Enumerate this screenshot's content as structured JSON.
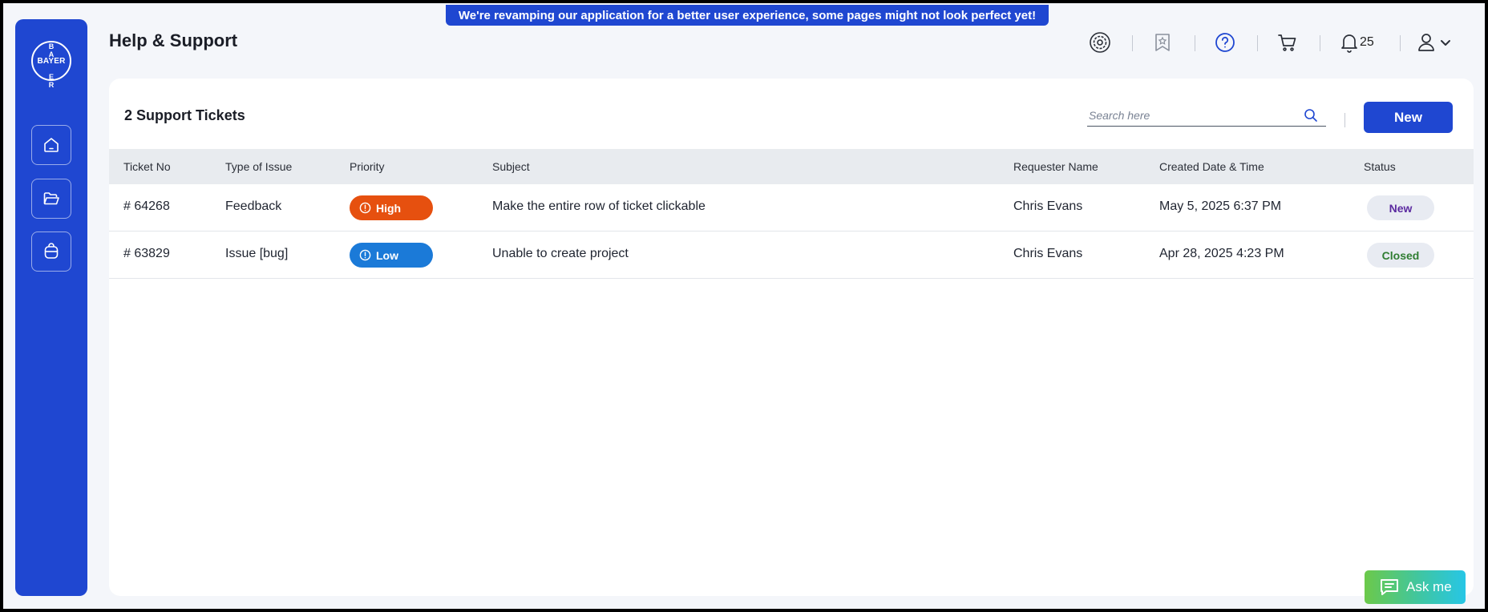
{
  "banner": {
    "text": "We're revamping our application for a better user experience, some pages might not look perfect yet!"
  },
  "sidebar": {
    "logo_text": "BAYER",
    "items": [
      {
        "name": "home",
        "icon": "home-icon"
      },
      {
        "name": "folder",
        "icon": "folder-icon"
      },
      {
        "name": "bag",
        "icon": "bag-icon"
      }
    ]
  },
  "header": {
    "title": "Help & Support",
    "icons": [
      "settings-gear-icon",
      "bookmark-badge-icon",
      "help-question-icon",
      "cart-icon",
      "bell-icon",
      "user-icon",
      "chevron-down-icon"
    ],
    "notification_count": "25"
  },
  "tickets": {
    "title": "2 Support Tickets",
    "search_placeholder": "Search here",
    "new_button": "New",
    "columns": [
      "Ticket No",
      "Type of Issue",
      "Priority",
      "Subject",
      "Requester Name",
      "Created Date & Time",
      "Status"
    ],
    "rows": [
      {
        "ticket_no": "# 64268",
        "type": "Feedback",
        "priority": "High",
        "subject": "Make the entire row of ticket clickable",
        "requester": "Chris Evans",
        "created": "May 5, 2025 6:37 PM",
        "status": "New"
      },
      {
        "ticket_no": "# 63829",
        "type": "Issue [bug]",
        "priority": "Low",
        "subject": "Unable to create project",
        "requester": "Chris Evans",
        "created": "Apr 28, 2025 4:23 PM",
        "status": "Closed"
      }
    ]
  },
  "colors": {
    "brand": "#1f47d1",
    "priority_high": "#e6500f",
    "priority_low": "#1b7ad8",
    "status_new_text": "#5b2aa0",
    "status_closed_text": "#2f7d32"
  },
  "ask_me": {
    "label": "Ask me",
    "icon": "chat-bubble-icon"
  }
}
